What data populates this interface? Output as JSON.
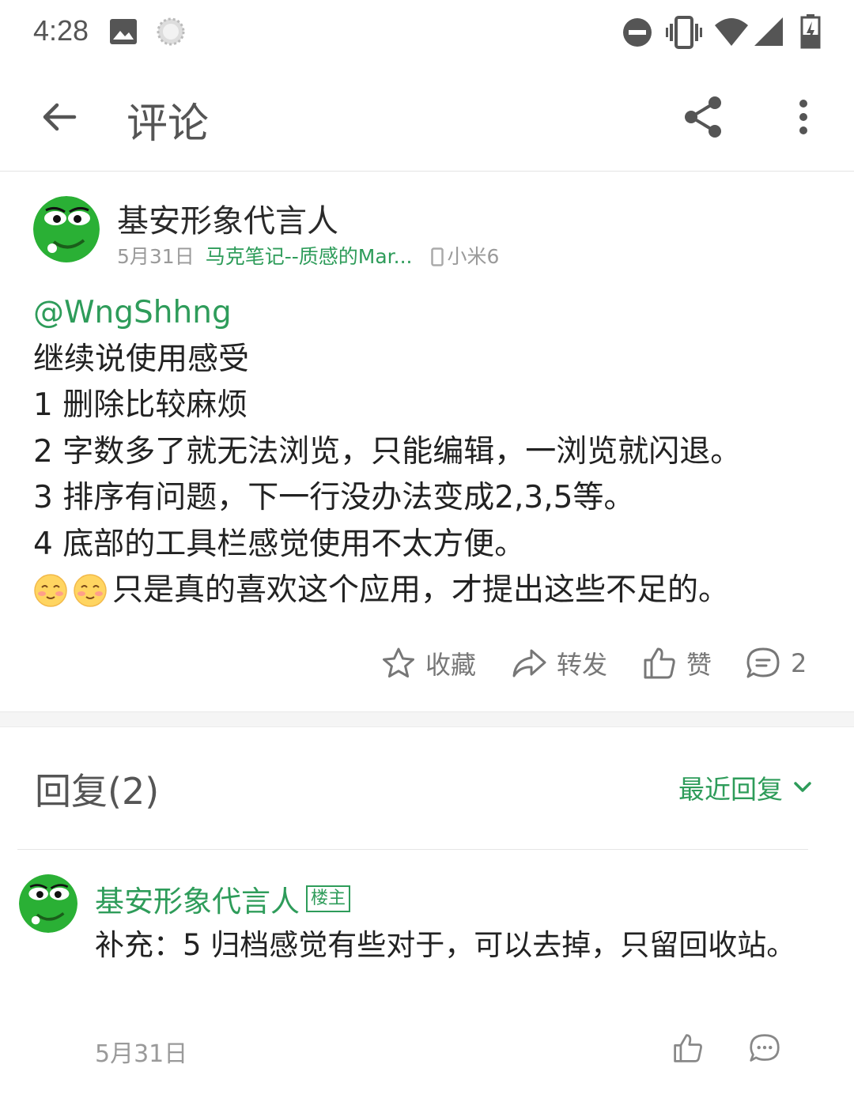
{
  "status_bar": {
    "time": "4:28",
    "icons": [
      "image-icon",
      "sync-icon",
      "do-not-disturb-icon",
      "vibrate-icon",
      "wifi-icon",
      "signal-icon",
      "battery-charging-icon"
    ]
  },
  "app_bar": {
    "back_icon": "arrow-back-icon",
    "title": "评论",
    "share_icon": "share-icon",
    "more_icon": "more-vert-icon"
  },
  "post": {
    "author": "基安形象代言人",
    "date": "5月31日",
    "topic": "马克笔记--质感的Mar...",
    "device": "小米6",
    "mention": "@WngShhng",
    "lines": [
      "继续说使用感受",
      "1 删除比较麻烦",
      "2 字数多了就无法浏览，只能编辑，一浏览就闪退。",
      "3 排序有问题，下一行没办法变成2,3,5等。",
      "4 底部的工具栏感觉使用不太方便。",
      "只是真的喜欢这个应用，才提出这些不足的。"
    ],
    "actions": {
      "favorite": "收藏",
      "forward": "转发",
      "like": "赞",
      "comment_count": "2"
    }
  },
  "replies": {
    "title": "回复(2)",
    "sort_label": "最近回复",
    "items": [
      {
        "author": "基安形象代言人",
        "badge": "楼主",
        "text": "补充：5 归档感觉有些对于，可以去掉，只留回收站。",
        "date": "5月31日"
      }
    ]
  },
  "colors": {
    "accent": "#2e9c5a",
    "avatar_green": "#2ab035"
  }
}
